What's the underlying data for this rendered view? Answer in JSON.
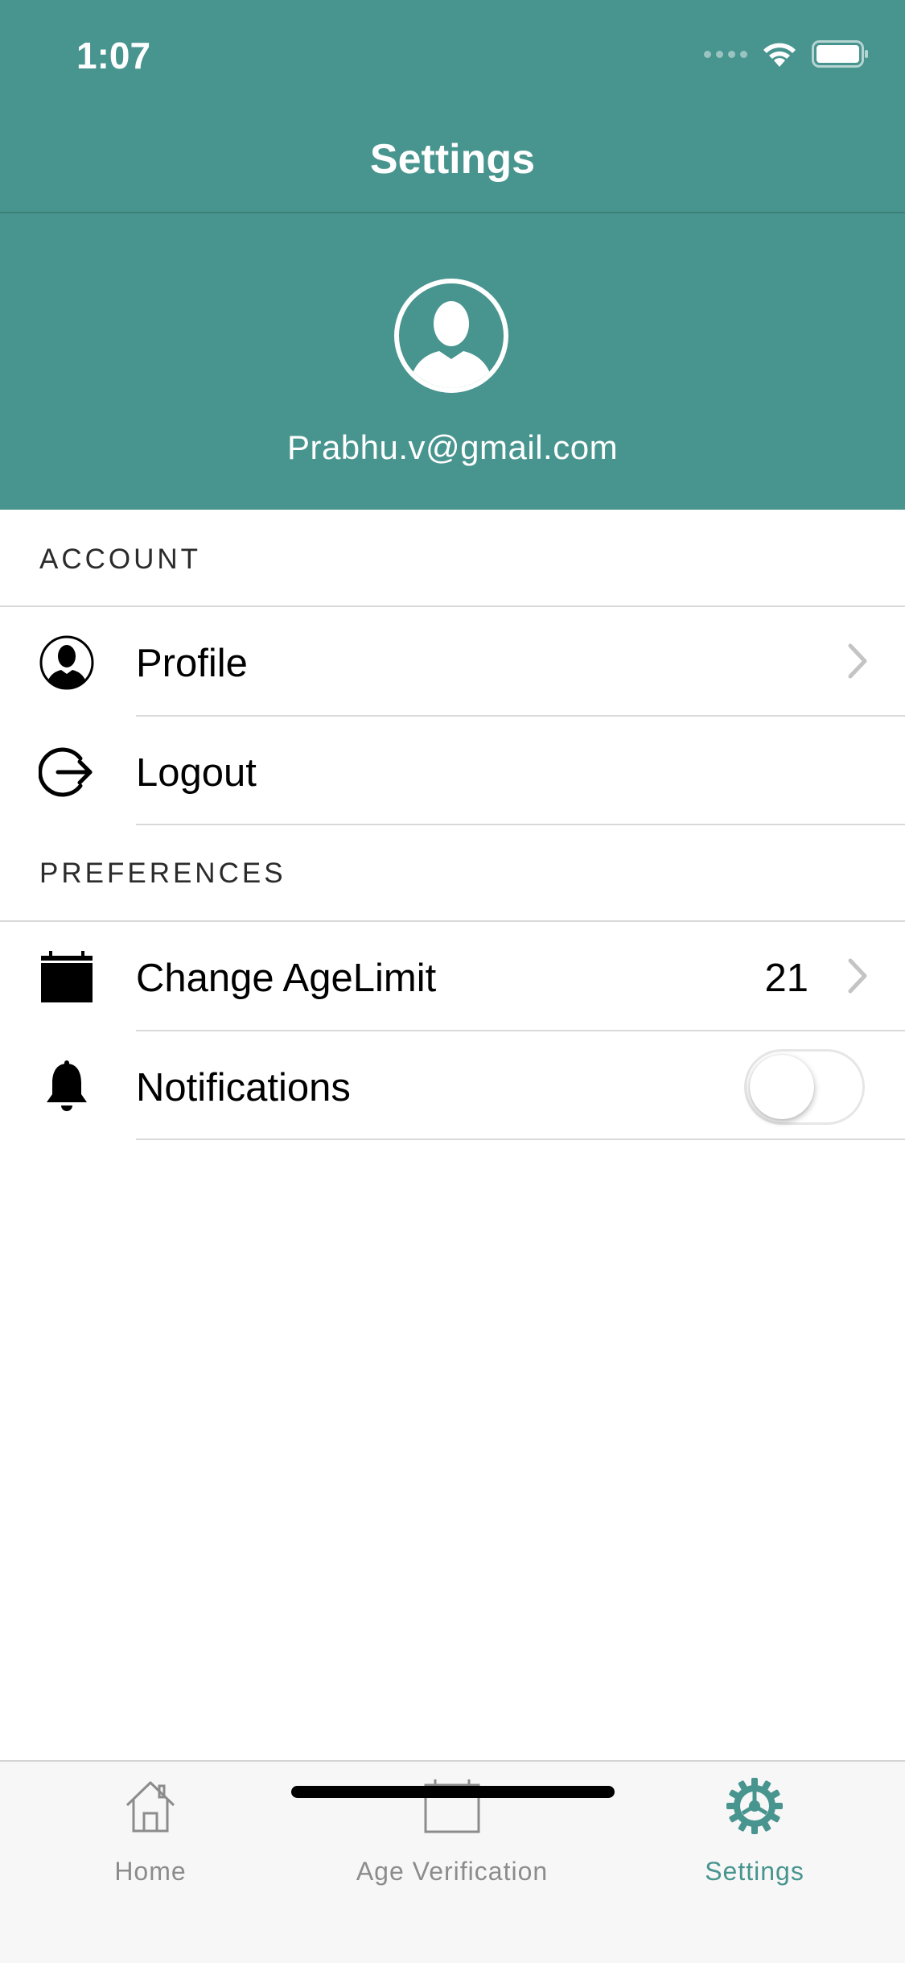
{
  "status_bar": {
    "time": "1:07"
  },
  "nav": {
    "title": "Settings"
  },
  "profile_header": {
    "email": "Prabhu.v@gmail.com"
  },
  "sections": {
    "account": {
      "title": "ACCOUNT",
      "items": [
        {
          "label": "Profile",
          "icon": "person-icon"
        },
        {
          "label": "Logout",
          "icon": "logout-icon"
        }
      ]
    },
    "preferences": {
      "title": "PREFERENCES",
      "items": [
        {
          "label": "Change AgeLimit",
          "value": "21",
          "icon": "calendar-icon"
        },
        {
          "label": "Notifications",
          "icon": "bell-icon",
          "toggle_on": false
        }
      ]
    }
  },
  "tabbar": {
    "tabs": [
      {
        "label": "Home",
        "icon": "home-icon",
        "active": false
      },
      {
        "label": "Age Verification",
        "icon": "calendar-icon",
        "active": false
      },
      {
        "label": "Settings",
        "icon": "gear-icon",
        "active": true
      }
    ]
  },
  "colors": {
    "primary": "#48948e",
    "inactive_tab": "#8c8c8c",
    "separator": "#d9d9d9"
  }
}
